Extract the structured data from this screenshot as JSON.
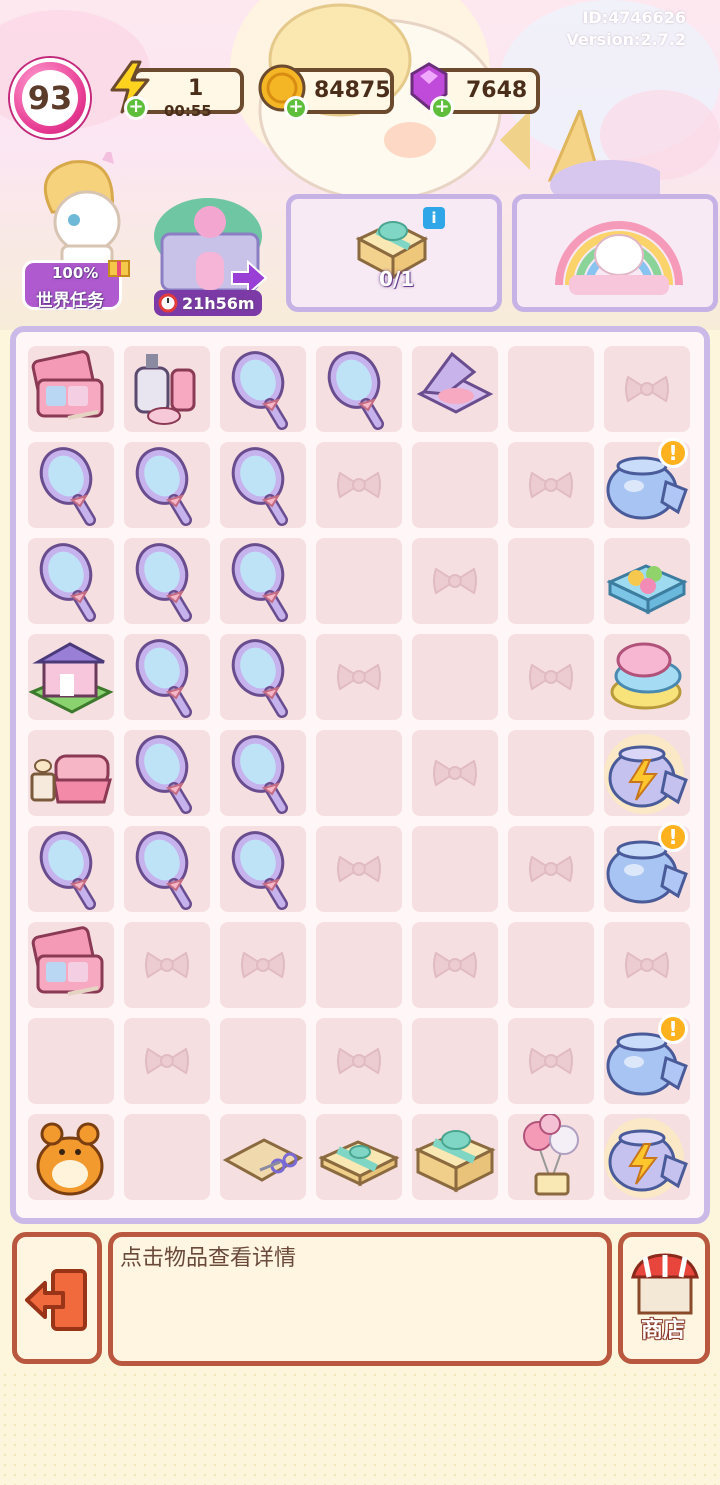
{
  "meta": {
    "id": "ID:4746626",
    "version": "Version:2.7.2"
  },
  "resources": {
    "level": "93",
    "energy": {
      "value": "1",
      "timer": "00:55"
    },
    "coins": "84875",
    "gems": "7648"
  },
  "header": {
    "world_tasks": {
      "percent": "100%",
      "label": "世界任务"
    },
    "event": {
      "timer": "21h56m"
    },
    "gift_card": {
      "progress": "0/1"
    }
  },
  "board": {
    "columns": 7,
    "rows": 9,
    "cells": [
      "palette-blush",
      "cosmetics-set",
      "hand-mirror",
      "hand-mirror",
      "compact-blush",
      "empty",
      "bow",
      "hand-mirror",
      "hand-mirror",
      "hand-mirror",
      "bow",
      "empty",
      "bow",
      "candy-jar-alert",
      "hand-mirror",
      "hand-mirror",
      "hand-mirror",
      "empty",
      "bow",
      "empty",
      "candy-box",
      "garden-house",
      "hand-mirror",
      "hand-mirror",
      "bow",
      "empty",
      "bow",
      "cotton-candy",
      "bed-set",
      "hand-mirror",
      "hand-mirror",
      "empty",
      "bow",
      "empty",
      "energy-jar",
      "hand-mirror",
      "hand-mirror",
      "hand-mirror",
      "bow",
      "empty",
      "bow",
      "candy-jar-alert",
      "palette-blush",
      "bow",
      "bow",
      "empty",
      "bow",
      "empty",
      "bow",
      "empty",
      "bow",
      "empty",
      "bow",
      "empty",
      "bow",
      "candy-jar-alert",
      "hamster",
      "empty",
      "craft-paper",
      "gift-box-small",
      "gift-box-big",
      "balloon-gift",
      "energy-jar"
    ]
  },
  "footer": {
    "hint": "点击物品查看详情",
    "shop_label": "商店"
  },
  "colors": {
    "board_border": "#cbbae8",
    "cell": "#f6dfe1",
    "frame_brown": "#b9583f",
    "accent_pink": "#e5368f"
  }
}
